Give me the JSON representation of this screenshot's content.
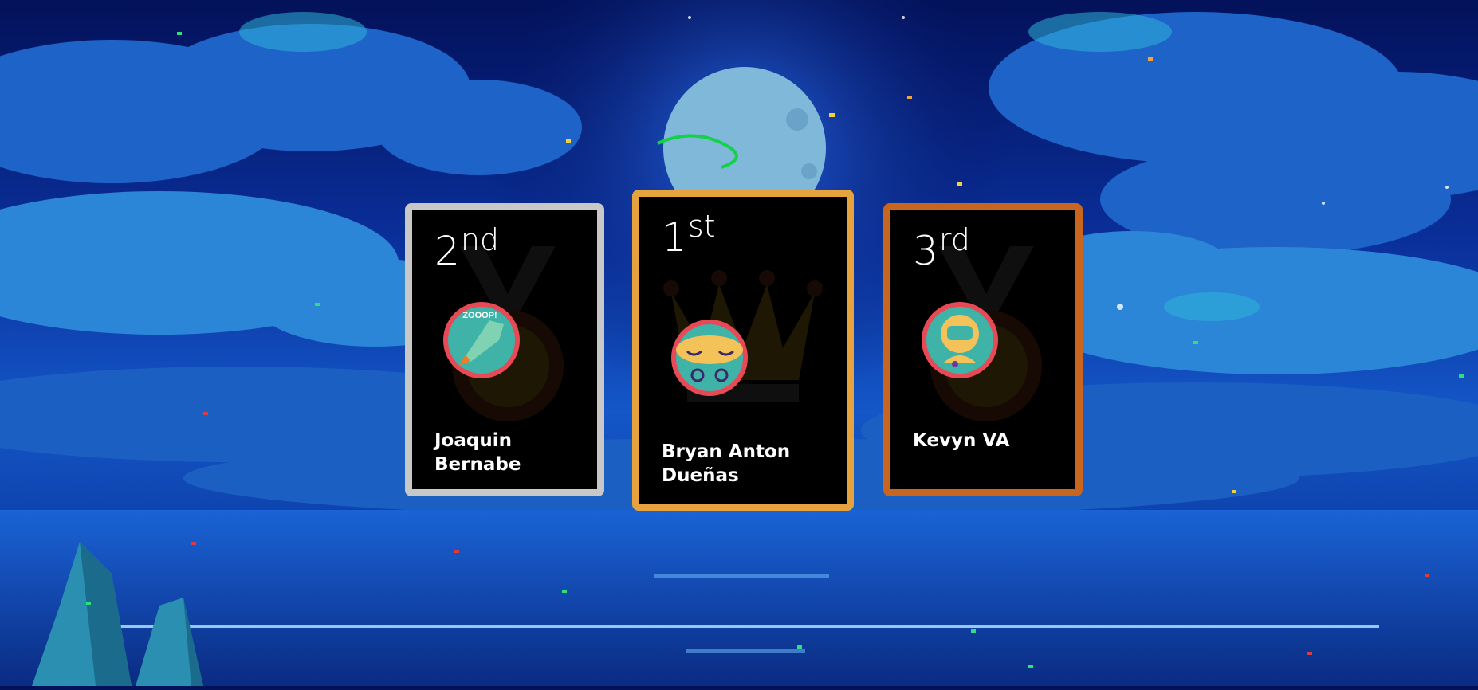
{
  "podium": [
    {
      "place_number": "2",
      "place_suffix": "nd",
      "name": "Joaquin Bernabe",
      "frame_color": "#c8c8c8",
      "avatar_icon": "rocket-zooop-icon"
    },
    {
      "place_number": "1",
      "place_suffix": "st",
      "name": "Bryan Anton Dueñas",
      "frame_color": "#e6a23c",
      "avatar_icon": "sleeping-robot-icon"
    },
    {
      "place_number": "3",
      "place_suffix": "rd",
      "name": "Kevyn VA",
      "frame_color": "#c8651e",
      "avatar_icon": "astronaut-icon"
    }
  ],
  "background": {
    "scene": "night-sky-moon-clouds-sea"
  }
}
